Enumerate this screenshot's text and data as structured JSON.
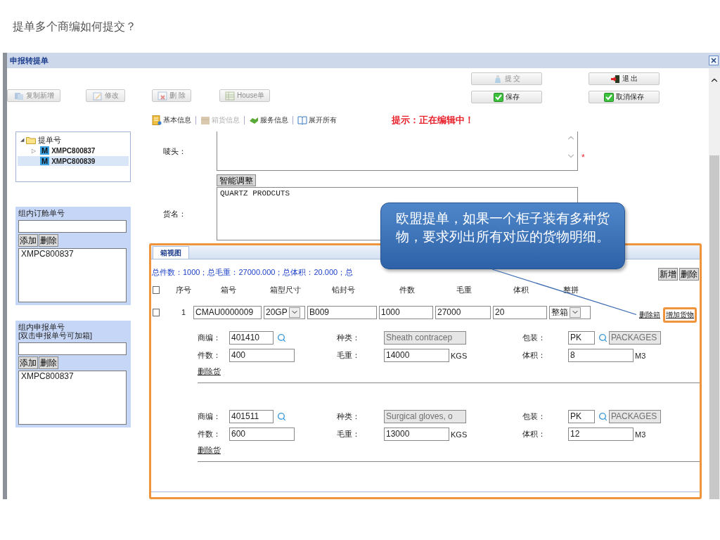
{
  "slide_title": "提单多个商编如何提交？",
  "window": {
    "title": "申报转提单"
  },
  "toolbar": {
    "left_buttons": [
      {
        "label": "复制新增",
        "kind": "copy",
        "disabled": true
      },
      {
        "label": "修改",
        "kind": "edit",
        "disabled": true
      },
      {
        "label": "删 除",
        "kind": "delete",
        "disabled": true
      },
      {
        "label": "House单",
        "kind": "house",
        "disabled": true
      }
    ],
    "right_buttons": [
      {
        "label": "提 交",
        "kind": "submit",
        "disabled": true
      },
      {
        "label": "退 出",
        "kind": "exit",
        "disabled": false
      },
      {
        "label": "保存",
        "kind": "save",
        "disabled": false
      },
      {
        "label": "取消保存",
        "kind": "save",
        "disabled": false
      }
    ]
  },
  "sections": [
    {
      "label": "基本信息",
      "kind": "doc",
      "disabled": false
    },
    {
      "label": "箱货信息",
      "kind": "box",
      "disabled": true
    },
    {
      "label": "服务信息",
      "kind": "hand",
      "disabled": false
    },
    {
      "label": "展开所有",
      "kind": "book",
      "disabled": false
    }
  ],
  "hint": "提示：正在编辑中！",
  "tree": {
    "label": "提单号",
    "expander": "◢",
    "expanded": true,
    "children": [
      {
        "label": "XMPC800837",
        "badge": "M",
        "kind": "branch",
        "expander": "▷",
        "selected": false
      },
      {
        "label": "XMPC800839",
        "badge": "M",
        "kind": "leaf",
        "selected": true
      }
    ]
  },
  "groups": [
    {
      "title": "组内订舱单号",
      "buttons": [
        "添加",
        "删除"
      ],
      "list": [
        "XMPC800837"
      ]
    },
    {
      "title": "组内申报单号",
      "subtitle": "[双击申报单号可加箱]",
      "buttons": [
        "添加",
        "删除"
      ],
      "list": [
        "XMPC800837"
      ]
    }
  ],
  "form": {
    "marks_label": "唛头：",
    "marks_required": true,
    "required_mark": "*",
    "smart_button": "智能调整",
    "goods_label": "货名：",
    "goods_value": "QUARTZ PRODCUTS"
  },
  "container_panel": {
    "highlighted": true,
    "tab": "箱视图",
    "summary": "总件数：1000；总毛重：27000.000；总体积：20.000；总",
    "buttons": [
      "新增",
      "删除"
    ],
    "header_checked": false,
    "columns": [
      "序号",
      "箱号",
      "箱型尺寸",
      "铅封号",
      "件数",
      "毛重",
      "体积",
      "整拼"
    ],
    "containers": [
      {
        "checked": false,
        "index": "1",
        "number": "CMAU0000009",
        "size": "20GP",
        "seal": "B009",
        "pieces": "1000",
        "weight": "27000",
        "volume": "20",
        "load_type": "整箱",
        "links": [
          {
            "label": "删除箱",
            "highlighted": false
          },
          {
            "label": "增加货物",
            "highlighted": true
          }
        ]
      }
    ],
    "goods": [
      {
        "fields": [
          {
            "label": "商编：",
            "kind": "lookup",
            "value": "401410"
          },
          {
            "label": "种类：",
            "kind": "readonly",
            "value": "Sheath contracep"
          },
          {
            "label": "包装：",
            "kind": "package",
            "value": "PK",
            "extra": "PACKAGES"
          },
          {
            "label": "件数：",
            "kind": "plain",
            "value": "400"
          },
          {
            "label": "毛重：",
            "kind": "unit",
            "value": "14000",
            "unit": "KGS"
          },
          {
            "label": "体积：",
            "kind": "unit",
            "value": "8",
            "unit": "M3"
          }
        ],
        "delete_link": "删除货"
      },
      {
        "fields": [
          {
            "label": "商编：",
            "kind": "lookup",
            "value": "401511"
          },
          {
            "label": "种类：",
            "kind": "readonly",
            "value": "Surgical gloves, o"
          },
          {
            "label": "包装：",
            "kind": "package",
            "value": "PK",
            "extra": "PACKAGES"
          },
          {
            "label": "件数：",
            "kind": "plain",
            "value": "600"
          },
          {
            "label": "毛重：",
            "kind": "unit",
            "value": "13000",
            "unit": "KGS"
          },
          {
            "label": "体积：",
            "kind": "unit",
            "value": "12",
            "unit": "M3"
          }
        ],
        "delete_link": "删除货"
      }
    ]
  },
  "callout": "欧盟提单，如果一个柜子装有多种货物，要求列出所有对应的货物明细。"
}
